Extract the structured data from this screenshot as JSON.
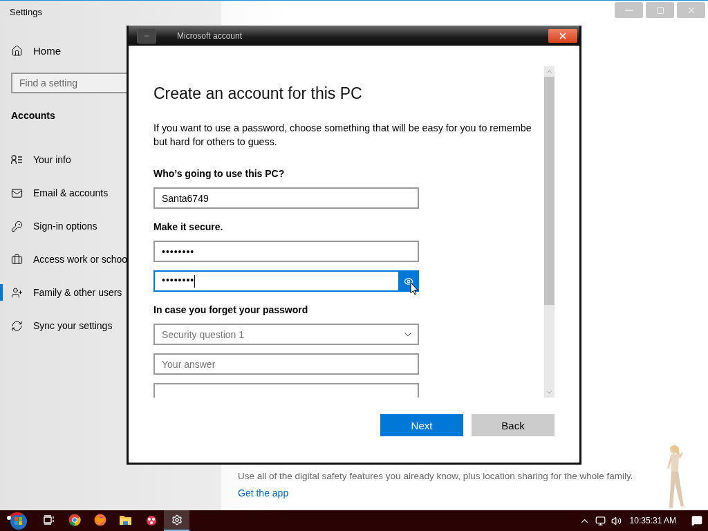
{
  "settings_window": {
    "title": "Settings",
    "nav": {
      "home": "Home",
      "search_placeholder": "Find a setting",
      "section": "Accounts",
      "items": [
        {
          "label": "Your info",
          "selected": false
        },
        {
          "label": "Email & accounts",
          "selected": false
        },
        {
          "label": "Sign-in options",
          "selected": false
        },
        {
          "label": "Access work or schoo",
          "selected": false
        },
        {
          "label": "Family & other users",
          "selected": true
        },
        {
          "label": "Sync your settings",
          "selected": false
        }
      ]
    },
    "content": {
      "description": "Use all of the digital safety features you already know, plus location sharing for the whole family.",
      "link": "Get the app"
    }
  },
  "dialog": {
    "title": "Microsoft account",
    "heading": "Create an account for this PC",
    "description_lines": [
      "If you want to use a password, choose something that will be easy for you to remembe",
      "but hard for others to guess."
    ],
    "sections": [
      {
        "label": "Who’s going to use this PC?",
        "fields": [
          {
            "kind": "text",
            "value": "Santa6749",
            "focused": false
          }
        ]
      },
      {
        "label": "Make it secure.",
        "fields": [
          {
            "kind": "password",
            "value": "••••••••",
            "focused": false
          },
          {
            "kind": "password",
            "value": "••••••••",
            "focused": true
          }
        ]
      },
      {
        "label": "In case you forget your password",
        "fields": [
          {
            "kind": "select",
            "placeholder": "Security question 1",
            "focused": false
          },
          {
            "kind": "text",
            "placeholder": "Your answer",
            "focused": false
          },
          {
            "kind": "partial",
            "focused": false
          }
        ]
      }
    ],
    "buttons": [
      {
        "label": "Next",
        "primary": true
      },
      {
        "label": "Back",
        "primary": false
      }
    ]
  },
  "taskbar": {
    "apps": [
      {
        "kind": "start",
        "active": false
      },
      {
        "kind": "task-view",
        "active": false
      },
      {
        "kind": "chrome",
        "active": false
      },
      {
        "kind": "firefox",
        "active": false
      },
      {
        "kind": "explorer",
        "active": false
      },
      {
        "kind": "app",
        "active": false
      },
      {
        "kind": "settings",
        "active": true
      }
    ],
    "clock": "10:35:31 AM"
  }
}
